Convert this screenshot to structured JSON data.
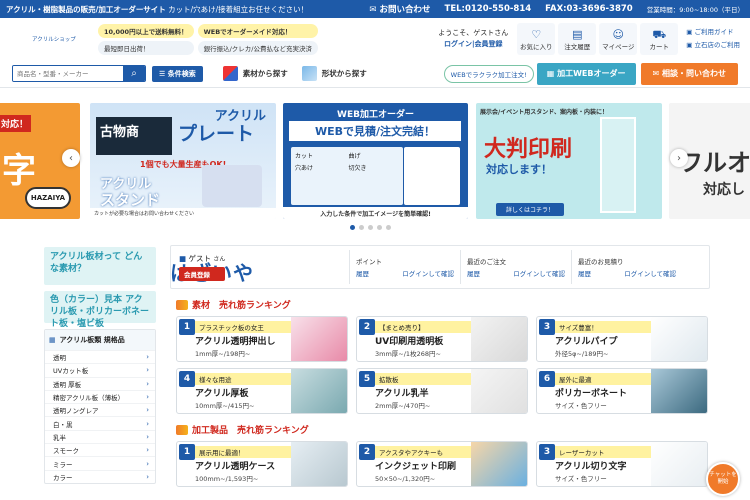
{
  "topbar": {
    "tagline_bold": "アクリル・樹脂製品の販売/加工オーダーサイト",
    "tagline": "カット/穴あけ/接着組立お任せください！",
    "contact": "お問い合わせ",
    "tel": "TEL:0120-550-814",
    "fax": "FAX:03-3696-3870",
    "hours": "営業時間：9:00~18:00（平日）"
  },
  "header": {
    "logo": "はざいや",
    "logo_sub": "アクリルショップ",
    "badges": [
      "10,000円以上で送料無料！",
      "WEBでオーダーメイド対応！",
      "最短即日出荷！",
      "銀行振込/クレカ/公費払など充実決済"
    ],
    "welcome": "ようこそ、ゲストさん",
    "login_links": "ログイン|会員登録",
    "icons": [
      {
        "label": "お気に入り",
        "icon": "heart-icon",
        "glyph": "♡"
      },
      {
        "label": "注文履歴",
        "icon": "history-icon",
        "glyph": "▤"
      },
      {
        "label": "マイページ",
        "icon": "user-icon",
        "glyph": "☺"
      },
      {
        "label": "カート",
        "icon": "cart-icon",
        "glyph": "⛟"
      }
    ],
    "guide": "ご利用ガイド",
    "store": "立石店のご利用"
  },
  "search": {
    "placeholder": "商品名・型番・メーカー",
    "conditions": "条件検索",
    "material": "素材から探す",
    "shape": "形状から探す",
    "web_tag": "WEBでラクラク加工注文!",
    "web_order": "加工WEBオーダー",
    "contact_btn": "相談・問い合わせ"
  },
  "carousel": {
    "slides": [
      {
        "t1": "対応！",
        "t2": "字"
      },
      {
        "t1": "アクリル",
        "t2": "プレート",
        "t3": "古物商",
        "t4": "1個でも大量生産もOK!",
        "t5": "アクリル",
        "t6": "スタンド",
        "t7": "カットが必要な場合はお問い合わせください"
      },
      {
        "t1": "WEB加工オーダー",
        "t2": "WEBで見積/注文完結！",
        "t3": "カット",
        "t4": "穴あけ",
        "t5": "曲げ",
        "t6": "切欠き",
        "t7": "入力した条件で加工イメージを簡単確認!"
      },
      {
        "t1": "展示会/イベント用スタンド、案内板・内装に！",
        "t2": "大判印刷",
        "t3": "対応します！",
        "t4": "詳しくはコチラ！"
      },
      {
        "t1": "フルオ",
        "t2": "対応し"
      }
    ]
  },
  "sidebar": {
    "banner1": "アクリル板材って どんな素材？",
    "banner2": "色（カラー）見本 アクリル板・ポリカーボネート板・塩ビ板",
    "heading": "アクリル板類 規格品",
    "items": [
      "透明",
      "UVカット板",
      "透明 厚板",
      "精密アクリル板（薄板）",
      "透明ノングレア",
      "白・黒",
      "乳半",
      "スモーク",
      "ミラー",
      "カラー"
    ]
  },
  "user": {
    "name": "ゲスト",
    "suffix": "さん",
    "register": "会員登録",
    "stats": [
      {
        "label": "ポイント",
        "k": "履歴",
        "v": "ログインして確認"
      },
      {
        "label": "最近のご注文",
        "k": "履歴",
        "v": "ログインして確認"
      },
      {
        "label": "最近のお見積り",
        "k": "履歴",
        "v": "ログインして確認"
      }
    ]
  },
  "ranking_material": {
    "title": "素材　売れ筋ランキング",
    "items": [
      {
        "rank": "1",
        "lead": "プラスチック板の女王",
        "name": "アクリル透明押出し",
        "spec": "1mm厚~/198円~"
      },
      {
        "rank": "2",
        "lead": "【まとめ売り】",
        "name": "UV印刷用透明板",
        "spec": "3mm厚~/1枚268円~"
      },
      {
        "rank": "3",
        "lead": "サイズ豊富！",
        "name": "アクリルパイプ",
        "spec": "外径5φ~/189円~"
      },
      {
        "rank": "4",
        "lead": "様々な用途",
        "name": "アクリル厚板",
        "spec": "10mm厚~/415円~"
      },
      {
        "rank": "5",
        "lead": "拡散板",
        "name": "アクリル乳半",
        "spec": "2mm厚~/470円~"
      },
      {
        "rank": "6",
        "lead": "屋外に最適",
        "name": "ポリカーボネート",
        "spec": "サイズ・色フリー"
      }
    ]
  },
  "ranking_products": {
    "title": "加工製品　売れ筋ランキング",
    "items": [
      {
        "rank": "1",
        "lead": "展示用に最適！",
        "name": "アクリル透明ケース",
        "spec": "100mm~/1,593円~"
      },
      {
        "rank": "2",
        "lead": "アクスタやアクキーも",
        "name": "インクジェット印刷",
        "spec": "50×50~/1,320円~"
      },
      {
        "rank": "3",
        "lead": "レーザーカット",
        "name": "アクリル切り文字",
        "spec": "サイズ・色フリー"
      }
    ]
  },
  "chat": "チャットを開始"
}
